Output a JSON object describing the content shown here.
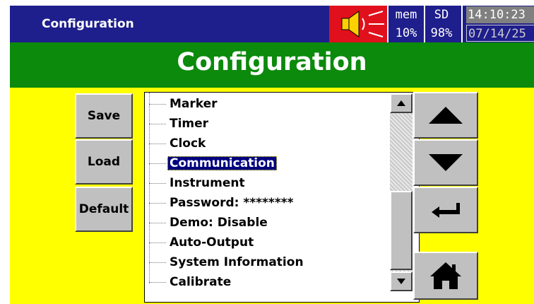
{
  "topbar": {
    "title": "Configuration",
    "speaker_icon": "speaker-alarm-icon",
    "mem_label": "mem",
    "mem_value": "10%",
    "sd_label": "SD",
    "sd_value": "98%",
    "time": "14:10:23",
    "date": "07/14/25"
  },
  "header": {
    "title": "Configuration"
  },
  "buttons": {
    "save": "Save",
    "load": "Load",
    "default": "Default"
  },
  "list": {
    "items": [
      "Marker",
      "Timer",
      "Clock",
      "Communication",
      "Instrument",
      "Password: ********",
      "Demo: Disable",
      "Auto-Output",
      "System Information",
      "Calibrate"
    ],
    "selected": "Communication"
  },
  "nav": {
    "up_icon": "up-arrow-icon",
    "down_icon": "down-arrow-icon",
    "enter_icon": "enter-icon",
    "home_icon": "home-icon"
  },
  "colors": {
    "topbar": "#1e1e8c",
    "header": "#0b8a0b",
    "background": "#ffff00",
    "alarm": "#e0101c",
    "selection": "#000080"
  }
}
